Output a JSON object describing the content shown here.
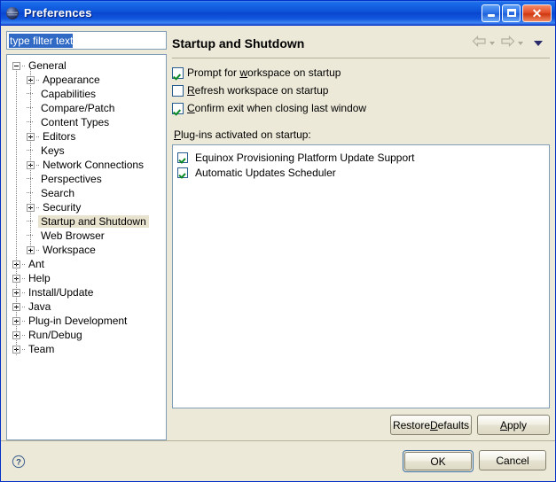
{
  "window": {
    "title": "Preferences",
    "icon": "eclipse-sphere-icon",
    "minimize_label": "Minimize",
    "maximize_label": "Maximize",
    "close_label": "Close",
    "close_glyph": "✕"
  },
  "filter": {
    "value": "type filter text",
    "placeholder": "type filter text"
  },
  "tree": {
    "items": [
      {
        "label": "General",
        "level": 0,
        "expander": "minus",
        "selected": false
      },
      {
        "label": "Appearance",
        "level": 1,
        "expander": "plus",
        "selected": false
      },
      {
        "label": "Capabilities",
        "level": 1,
        "expander": "none",
        "selected": false
      },
      {
        "label": "Compare/Patch",
        "level": 1,
        "expander": "none",
        "selected": false
      },
      {
        "label": "Content Types",
        "level": 1,
        "expander": "none",
        "selected": false
      },
      {
        "label": "Editors",
        "level": 1,
        "expander": "plus",
        "selected": false
      },
      {
        "label": "Keys",
        "level": 1,
        "expander": "none",
        "selected": false
      },
      {
        "label": "Network Connections",
        "level": 1,
        "expander": "plus",
        "selected": false
      },
      {
        "label": "Perspectives",
        "level": 1,
        "expander": "none",
        "selected": false
      },
      {
        "label": "Search",
        "level": 1,
        "expander": "none",
        "selected": false
      },
      {
        "label": "Security",
        "level": 1,
        "expander": "plus",
        "selected": false
      },
      {
        "label": "Startup and Shutdown",
        "level": 1,
        "expander": "none",
        "selected": true
      },
      {
        "label": "Web Browser",
        "level": 1,
        "expander": "none",
        "selected": false
      },
      {
        "label": "Workspace",
        "level": 1,
        "expander": "plus",
        "selected": false
      },
      {
        "label": "Ant",
        "level": 0,
        "expander": "plus",
        "selected": false
      },
      {
        "label": "Help",
        "level": 0,
        "expander": "plus",
        "selected": false
      },
      {
        "label": "Install/Update",
        "level": 0,
        "expander": "plus",
        "selected": false
      },
      {
        "label": "Java",
        "level": 0,
        "expander": "plus",
        "selected": false
      },
      {
        "label": "Plug-in Development",
        "level": 0,
        "expander": "plus",
        "selected": false
      },
      {
        "label": "Run/Debug",
        "level": 0,
        "expander": "plus",
        "selected": false
      },
      {
        "label": "Team",
        "level": 0,
        "expander": "plus",
        "selected": false
      }
    ]
  },
  "page": {
    "title": "Startup and Shutdown",
    "nav": {
      "back_label": "Back",
      "forward_label": "Forward",
      "menu_label": "View Menu"
    },
    "checkboxes": [
      {
        "label_before": "Prompt for ",
        "mnemonic": "w",
        "label_after": "orkspace on startup",
        "checked": true
      },
      {
        "label_before": "",
        "mnemonic": "R",
        "label_after": "efresh workspace on startup",
        "checked": false
      },
      {
        "label_before": "",
        "mnemonic": "C",
        "label_after": "onfirm exit when closing last window",
        "checked": true
      }
    ],
    "plugins_label": {
      "mnemonic": "P",
      "rest": "lug-ins activated on startup:"
    },
    "plugins": [
      {
        "label": "Equinox Provisioning Platform Update Support",
        "checked": true
      },
      {
        "label": "Automatic Updates Scheduler",
        "checked": true
      }
    ],
    "restore_defaults": {
      "before": "Restore ",
      "mnemonic": "D",
      "after": "efaults"
    },
    "apply": {
      "before": "",
      "mnemonic": "A",
      "after": "pply"
    }
  },
  "footer": {
    "help_label": "Help",
    "ok_label": "OK",
    "cancel_label": "Cancel"
  },
  "colors": {
    "titlebar_blue": "#0a46cf",
    "dialog_bg": "#ece9d8",
    "field_border": "#7f9db9",
    "selection_blue": "#316ac5",
    "tree_selection": "#e8e3cf",
    "check_green": "#0b8a23",
    "default_btn_border": "#3a6ea5"
  }
}
